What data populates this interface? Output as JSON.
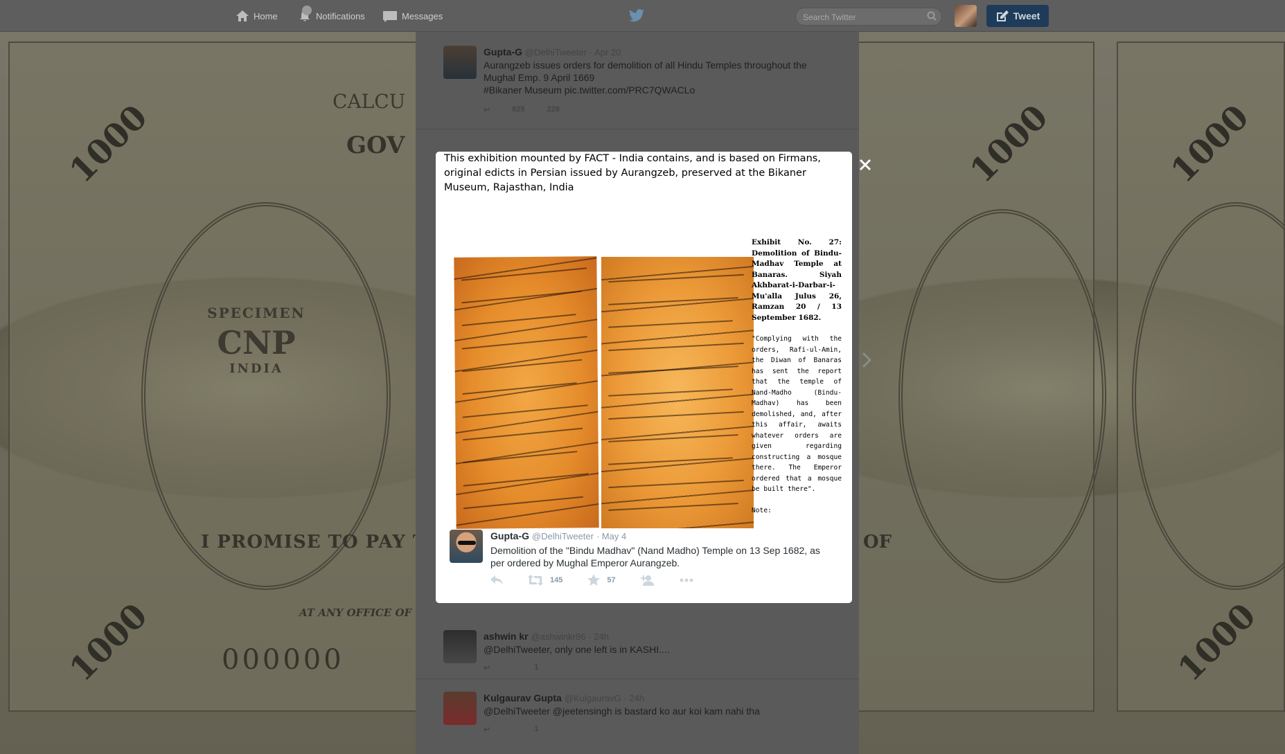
{
  "nav": {
    "home_label": "Home",
    "notifications_label": "Notifications",
    "notifications_count": "",
    "messages_label": "Messages",
    "search_placeholder": "Search Twitter",
    "tweet_button_label": "Tweet"
  },
  "background": {
    "calcutta_text": "CALCU",
    "gov_text": "GOV",
    "specimen_top": "SPECIMEN",
    "specimen_mid": "CNP",
    "specimen_bottom": "INDIA",
    "promise_text": "I PROMISE TO PAY THE B",
    "serial_text": "000000",
    "denomination_text": "1000",
    "right_text": "OF",
    "office_text": "AT ANY OFFICE OF"
  },
  "timeline": {
    "tweets": [
      {
        "name": "Gupta-G",
        "handle": "@DelhiTweeter",
        "time": "· Apr 20",
        "text_line1": "Aurangzeb issues orders for demolition of all Hindu Temples throughout the",
        "text_line2": "Mughal Emp. 9 April 1669",
        "text_line3": "#Bikaner Museum pic.twitter.com/PRC7QWACLo",
        "retweets": "625",
        "favorites": "228"
      },
      {
        "name": "ashwin kr",
        "handle": "@ashwinkr86",
        "time": "· 24h",
        "text": "@DelhiTweeter, only one left is in KASHI....",
        "retweets": "",
        "favorites": "1"
      },
      {
        "name": "Kulgaurav Gupta",
        "handle": "@KulgauravG",
        "time": "· 24h",
        "text": "@DelhiTweeter @jeetensingh is bastard ko aur koi kam nahi tha",
        "retweets": "",
        "favorites": "1"
      }
    ]
  },
  "modal": {
    "caption": "This exhibition mounted by FACT - India contains, and is based on Firmans, original edicts in Persian issued by Aurangzeb, preserved at the Bikaner Museum, Rajasthan, India",
    "exhibit_heading": "Exhibit No. 27: Demolition of Bindu-Madhav Temple at Banaras. Siyah Akhbarat-i-Darbar-i-Mu'alla Julus 26, Ramzan 20 / 13 September 1682.",
    "exhibit_quote": "\"Complying with the orders, Rafi-ul-Amin, the Diwan of Banaras has sent the report that the temple of Nand-Madho (Bindu- Madhav) has been demolished, and, after this affair, awaits whatever orders are given regarding constructing a mosque there. The Emperor ordered that a mosque be built there\".",
    "exhibit_note": "Note:",
    "tweet": {
      "name": "Gupta-G",
      "handle": "@DelhiTweeter",
      "time": "· May 4",
      "text": "Demolition of the \"Bindu Madhav\" (Nand Madho) Temple on 13 Sep 1682, as per ordered by Mughal Emperor Aurangzeb.",
      "retweets": "145",
      "favorites": "57"
    }
  },
  "colors": {
    "overlay": "#5e5e5e",
    "tweet_button": "#1e3b59",
    "manuscript_orange": "#e58c2b",
    "action_icon": "#ccd6dd",
    "meta_text": "#8899a6"
  }
}
